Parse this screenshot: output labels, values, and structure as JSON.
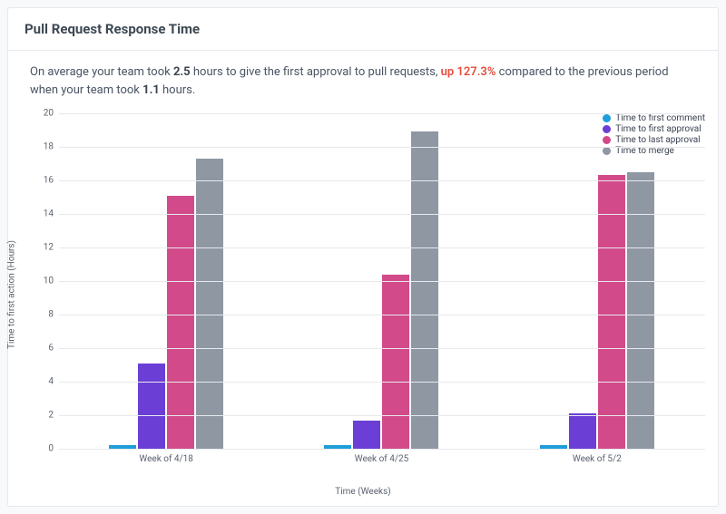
{
  "card": {
    "title": "Pull Request Response Time",
    "summary_prefix": "On average your team took ",
    "avg_current": "2.5",
    "summary_mid1": " hours to give the first approval to pull requests, ",
    "delta": "up 127.3%",
    "summary_mid2": " compared to the previous period when your team took ",
    "avg_prev": "1.1",
    "summary_suffix": " hours."
  },
  "chart_data": {
    "type": "bar",
    "title": "",
    "xlabel": "Time (Weeks)",
    "ylabel": "Time to first action (Hours)",
    "categories": [
      "Week of 4/18",
      "Week of 4/25",
      "Week of 5/2"
    ],
    "series": [
      {
        "name": "Time to first comment",
        "color": "#1f9ed9",
        "values": [
          0.2,
          0.2,
          0.2
        ]
      },
      {
        "name": "Time to first approval",
        "color": "#6b3fd6",
        "values": [
          5.1,
          1.7,
          2.1
        ]
      },
      {
        "name": "Time to last approval",
        "color": "#d24a8a",
        "values": [
          15.1,
          10.4,
          16.3
        ]
      },
      {
        "name": "Time to merge",
        "color": "#8f97a3",
        "values": [
          17.3,
          18.9,
          16.5
        ]
      }
    ],
    "yticks": [
      0,
      2,
      4,
      6,
      8,
      10,
      12,
      14,
      16,
      18,
      20
    ],
    "ylim": [
      0,
      20
    ],
    "legend_position": "top-right",
    "grid": true
  }
}
